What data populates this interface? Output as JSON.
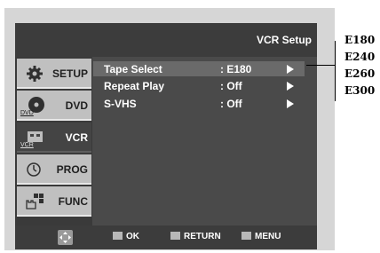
{
  "header": {
    "title": "VCR Setup"
  },
  "sidebar": {
    "tabs": [
      {
        "label": "SETUP",
        "icon": "gear-icon",
        "sub": ""
      },
      {
        "label": "DVD",
        "icon": "disc-icon",
        "sub": "DVD"
      },
      {
        "label": "VCR",
        "icon": "vcr-icon",
        "sub": "VCR"
      },
      {
        "label": "PROG",
        "icon": "clock-icon",
        "sub": ""
      },
      {
        "label": "FUNC",
        "icon": "function-icon",
        "sub": ""
      }
    ]
  },
  "menu": {
    "rows": [
      {
        "label": "Tape Select",
        "value": ": E180"
      },
      {
        "label": "Repeat Play",
        "value": ": Off"
      },
      {
        "label": "S-VHS",
        "value": ": Off"
      }
    ]
  },
  "footer": {
    "ok": "OK",
    "return": "RETURN",
    "menu": "MENU"
  },
  "options": [
    "E180",
    "E240",
    "E260",
    "E300"
  ],
  "colors": {
    "screen": "#4a4a4a",
    "tab_inactive": "#c0c0c0",
    "highlight": "#6a6a6a"
  }
}
